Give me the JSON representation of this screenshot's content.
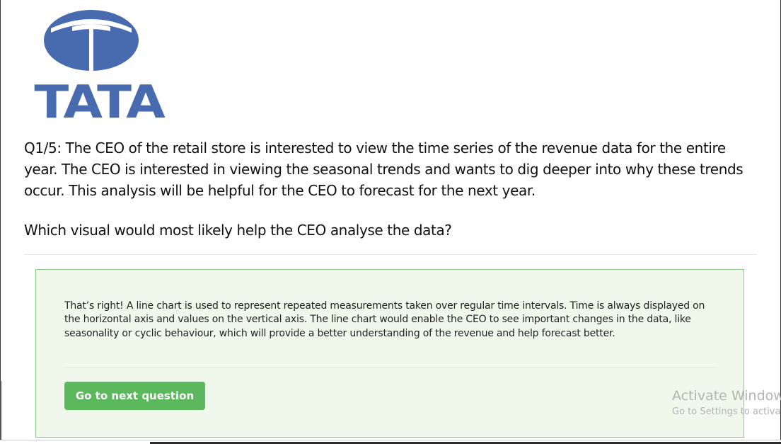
{
  "logo": {
    "wordmark": "TATA",
    "color": "#486aaf",
    "icon": "tata-logo-icon"
  },
  "quiz": {
    "question": "Q1/5: The CEO of the retail store is interested to view the time series of the revenue data for the entire year. The CEO is interested in viewing the seasonal trends and wants to dig deeper into why these trends occur. This analysis will be helpful for the CEO to forecast for the next year.",
    "prompt": "Which visual would most likely help the CEO analyse the data?"
  },
  "feedback": {
    "text": "That’s right! A line chart is used to represent repeated measurements taken over regular time intervals. Time is always displayed on the horizontal axis and values on the vertical axis.  The line chart would enable the CEO to see important changes in the data, like seasonality or cyclic behaviour, which will provide a better understanding of the revenue and help forecast better.",
    "next_button_label": "Go to next question",
    "accent_color": "#5cb85c",
    "background_color": "#f0f8ec"
  },
  "watermark": {
    "title": "Activate Windows",
    "subtitle": "Go to Settings to activate Windows."
  }
}
